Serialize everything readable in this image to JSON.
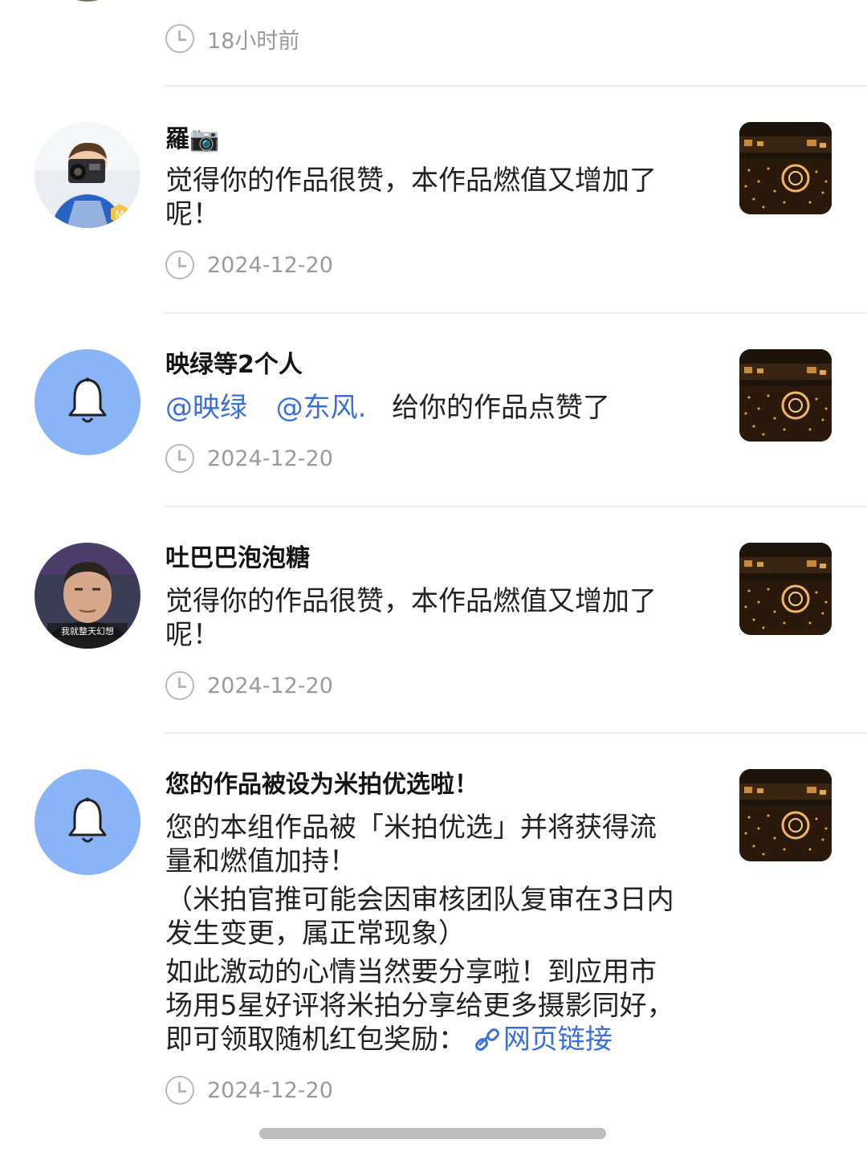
{
  "top_item": {
    "time": "18小时前"
  },
  "notifications": [
    {
      "title": "羅📷",
      "lines": [
        "觉得你的作品很赞，本作品燃值又增加了",
        "呢！"
      ],
      "time": "2024-12-20",
      "avatar": "photo-child-camera",
      "badge": "M"
    },
    {
      "title": "映绿等2个人",
      "mentions": [
        "@映绿",
        "@东风."
      ],
      "text": "给你的作品点赞了",
      "time": "2024-12-20",
      "avatar": "bell-icon"
    },
    {
      "title": "吐巴巴泡泡糖",
      "lines": [
        "觉得你的作品很赞，本作品燃值又增加了",
        "呢！"
      ],
      "time": "2024-12-20",
      "avatar": "photo-man",
      "avatar_caption": "我就整天幻想"
    },
    {
      "title": "您的作品被设为米拍优选啦！",
      "lines": [
        "您的本组作品被「米拍优选」并将获得流",
        "量和燃值加持！",
        "（米拍官推可能会因审核团队复审在3日内",
        "发生变更，属正常现象）",
        "如此激动的心情当然要分享啦！到应用市",
        "场用5星好评将米拍分享给更多摄影同好，"
      ],
      "last_line": "即可领取随机红包奖励：",
      "link_text": "网页链接",
      "time": "2024-12-20",
      "avatar": "bell-icon"
    }
  ],
  "colors": {
    "bell_avatar": "#8ab4f8",
    "link": "#3a6fd8",
    "muted": "#9a9a9a"
  }
}
